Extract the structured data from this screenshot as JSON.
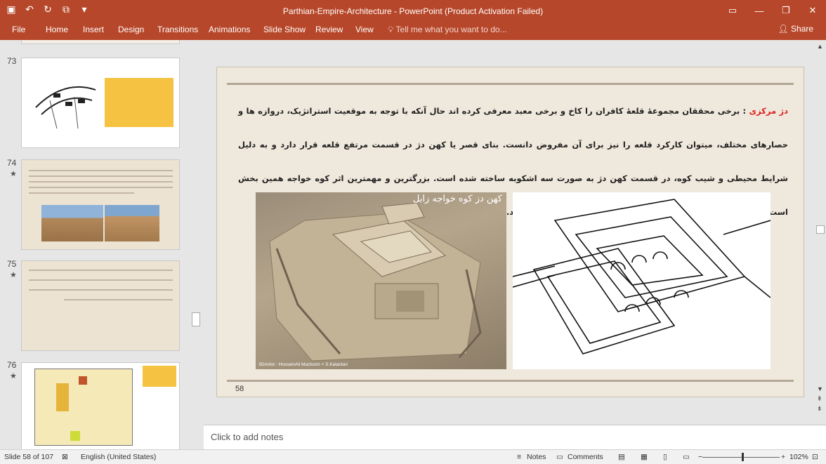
{
  "window": {
    "title": "Parthian-Empire-Architecture  -  PowerPoint (Product Activation Failed)",
    "qat_icons": [
      "save-icon",
      "undo-icon",
      "redo-icon",
      "present-icon",
      "customize-icon"
    ],
    "controls": [
      "ribbon-display-icon",
      "minimize-icon",
      "restore-icon",
      "close-icon"
    ]
  },
  "ribbon": {
    "tabs": [
      "File",
      "Home",
      "Insert",
      "Design",
      "Transitions",
      "Animations",
      "Slide Show",
      "Review",
      "View"
    ],
    "tell_me": "Tell me what you want to do...",
    "share": "Share"
  },
  "thumbnails": [
    {
      "number": "73",
      "star": ""
    },
    {
      "number": "74",
      "star": "★"
    },
    {
      "number": "75",
      "star": "★"
    },
    {
      "number": "76",
      "star": "★"
    }
  ],
  "slide": {
    "heading": "دژ مرکزی",
    "body": " : برخی محققان مجموعهٔ قلعهٔ کافران را کاخ و برخی معبد معرفی کرده اند حال آنکه با توجه به موقعیت استراتژیک، دروازه ها و حصارهای مختلف، میتوان کارکرد قلعه را نیز برای آن مفروض دانست. بنای قصر یا کهن دژ در قسمت مرتفع قلعه قرار دارد و به دلیل شرایط محیطی و شیب کوه، در قسمت کهن دژ به صورت سه اشکوبه ساخته شده است. بزرگترین و مهمترین اثر کوه خواجه همین بخش است که حیاط مرکزی، اتاقها، رواقهای جانبی و آتشکده را در بر میگیرد.",
    "image1_caption": "کهن دز کوه خواجه زابل",
    "image1_credit": "3DArtist : HosseinAli Maztoom + S.Kalantari",
    "number": "58"
  },
  "notes": {
    "placeholder": "Click to add notes"
  },
  "status": {
    "slide_of": "Slide 58 of 107",
    "language": "English (United States)",
    "notes": "Notes",
    "comments": "Comments",
    "zoom": "102%"
  }
}
